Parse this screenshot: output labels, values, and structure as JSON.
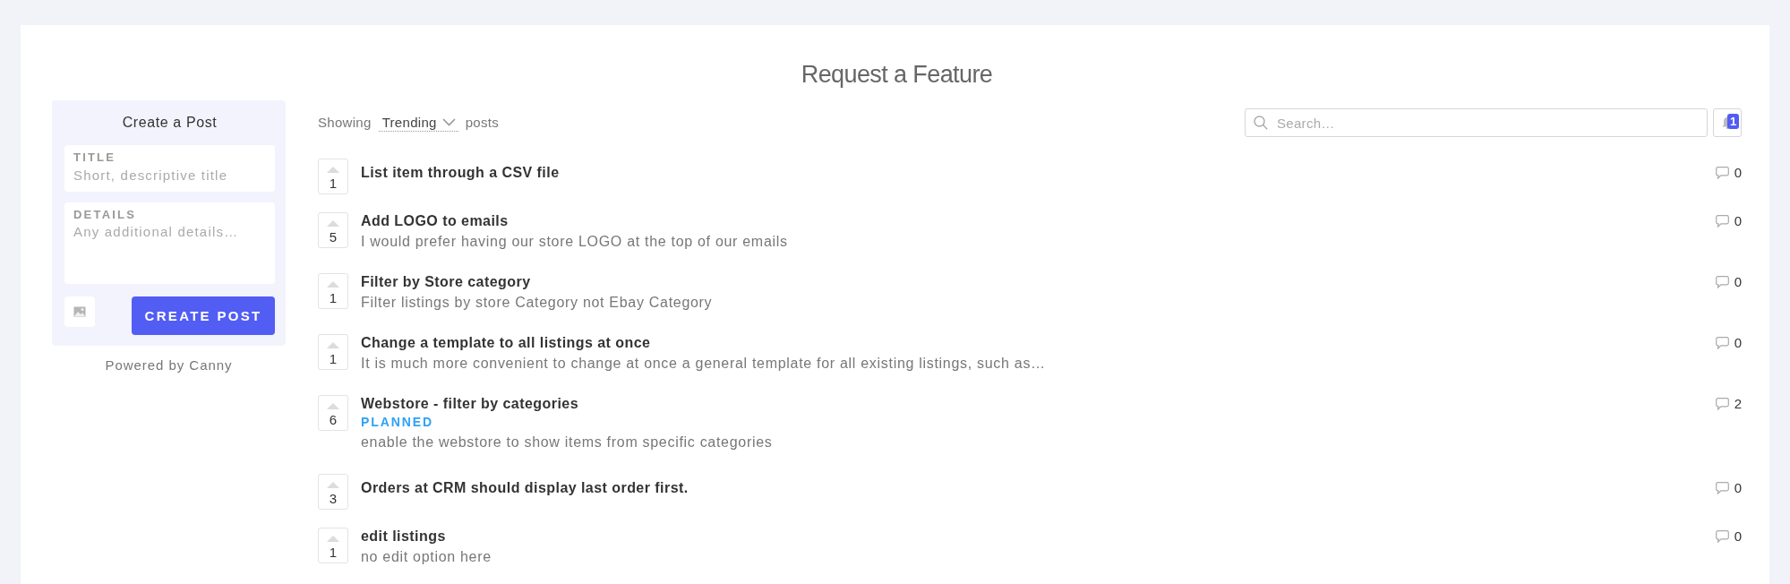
{
  "page": {
    "title": "Request a Feature"
  },
  "create_post": {
    "heading": "Create a Post",
    "fields": [
      {
        "kind": "line",
        "label": "TITLE",
        "placeholder": "Short, descriptive title"
      },
      {
        "kind": "area",
        "label": "DETAILS",
        "placeholder": "Any additional details…"
      }
    ],
    "submit_button": "CREATE POST",
    "footer": "Powered by Canny"
  },
  "toolbar": {
    "prefix": "Showing",
    "sort": "Trending",
    "suffix": "posts",
    "search": {
      "placeholder": "Search…"
    },
    "notifications": {
      "badge": "1"
    }
  },
  "posts": [
    {
      "votes": "1",
      "title": "List item through a CSV file",
      "comments": "0"
    },
    {
      "votes": "5",
      "title": "Add LOGO to emails",
      "details": "I would prefer having our store LOGO at the top of our emails",
      "comments": "0"
    },
    {
      "votes": "1",
      "title": "Filter by Store category",
      "details": "Filter listings by store Category not Ebay Category",
      "comments": "0"
    },
    {
      "votes": "1",
      "title": "Change a template to all listings at once",
      "details": "It is much more convenient to change at once a general template for all existing listings, such as…",
      "comments": "0"
    },
    {
      "votes": "6",
      "title": "Webstore - filter by categories",
      "status": "PLANNED",
      "details": "enable the webstore to show items from specific categories",
      "comments": "2"
    },
    {
      "votes": "3",
      "title": "Orders at CRM should display last order first.",
      "comments": "0"
    },
    {
      "votes": "1",
      "title": "edit listings",
      "details": "no edit option here",
      "comments": "0"
    }
  ]
}
